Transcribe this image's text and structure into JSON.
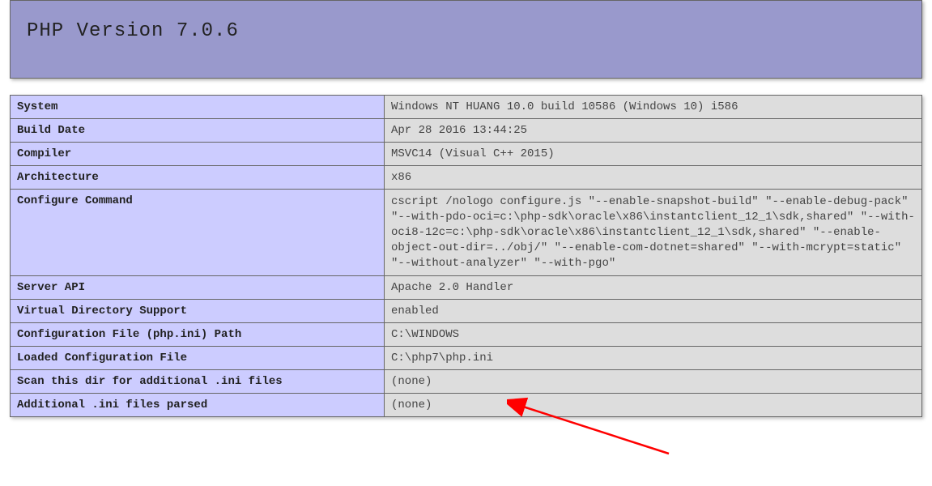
{
  "header": {
    "title": "PHP Version 7.0.6"
  },
  "rows": [
    {
      "label": "System",
      "value": "Windows NT HUANG 10.0 build 10586 (Windows 10) i586"
    },
    {
      "label": "Build Date",
      "value": "Apr 28 2016 13:44:25"
    },
    {
      "label": "Compiler",
      "value": "MSVC14 (Visual C++ 2015)"
    },
    {
      "label": "Architecture",
      "value": "x86"
    },
    {
      "label": "Configure Command",
      "value": "cscript /nologo configure.js \"--enable-snapshot-build\" \"--enable-debug-pack\" \"--with-pdo-oci=c:\\php-sdk\\oracle\\x86\\instantclient_12_1\\sdk,shared\" \"--with-oci8-12c=c:\\php-sdk\\oracle\\x86\\instantclient_12_1\\sdk,shared\" \"--enable-object-out-dir=../obj/\" \"--enable-com-dotnet=shared\" \"--with-mcrypt=static\" \"--without-analyzer\" \"--with-pgo\"",
      "multiline": true
    },
    {
      "label": "Server API",
      "value": "Apache 2.0 Handler"
    },
    {
      "label": "Virtual Directory Support",
      "value": "enabled"
    },
    {
      "label": "Configuration File (php.ini) Path",
      "value": "C:\\WINDOWS"
    },
    {
      "label": "Loaded Configuration File",
      "value": "C:\\php7\\php.ini"
    },
    {
      "label": "Scan this dir for additional .ini files",
      "value": "(none)"
    },
    {
      "label": "Additional .ini files parsed",
      "value": "(none)"
    }
  ],
  "annotation": {
    "arrow_target_row_index": 8,
    "arrow_color": "#ff0000"
  }
}
